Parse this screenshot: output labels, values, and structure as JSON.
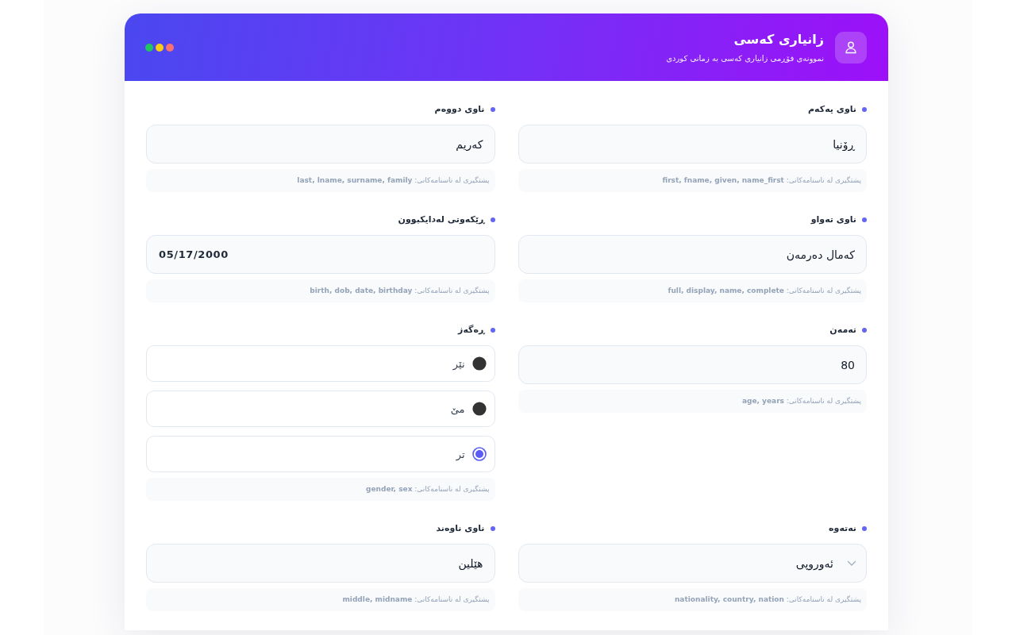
{
  "window": {
    "title": "زانیاری کەسی",
    "subtitle": "نموونەی فۆڕمی زانیاری کەسی بە زمانی کوردی"
  },
  "fields": [
    {
      "kind": "text",
      "label": "ناوی یەکەم",
      "value": "ڕۆنیا",
      "hint": "پشتگیری لە ناسنامەکانی: **first, fname, given, name_first**"
    },
    {
      "kind": "text",
      "label": "ناوی دووەم",
      "value": "کەریم",
      "hint": "پشتگیری لە ناسنامەکانی: **last, lname, surname, family**"
    },
    {
      "kind": "text",
      "label": "ناوی تەواو",
      "value": "کەمال دەرمەن",
      "hint": "پشتگیری لە ناسنامەکانی: **full, display, name, complete**"
    },
    {
      "kind": "date",
      "label": "ڕێکەوتی لەدایکبوون",
      "value": "05/17/2000",
      "hint": "پشتگیری لە ناسنامەکانی: **birth, dob, date, birthday**"
    },
    {
      "kind": "number",
      "label": "تەمەن",
      "value": "80",
      "hint": "پشتگیری لە ناسنامەکانی: **age, years**"
    },
    {
      "kind": "radio",
      "label": "ڕەگەز",
      "options": [
        {
          "label": "نێر",
          "selected": false
        },
        {
          "label": "مێ",
          "selected": false
        },
        {
          "label": "تر",
          "selected": true
        }
      ],
      "hint": "پشتگیری لە ناسنامەکانی: **gender, sex**"
    },
    {
      "kind": "select",
      "label": "نەتەوە",
      "value": "ئەوروپی",
      "hint": "پشتگیری لە ناسنامەکانی: **nationality, country, nation**"
    },
    {
      "kind": "text",
      "label": "ناوی ناوەند",
      "value": "هێلین",
      "hint": "پشتگیری لە ناسنامەکانی: **middle, midname**"
    }
  ]
}
